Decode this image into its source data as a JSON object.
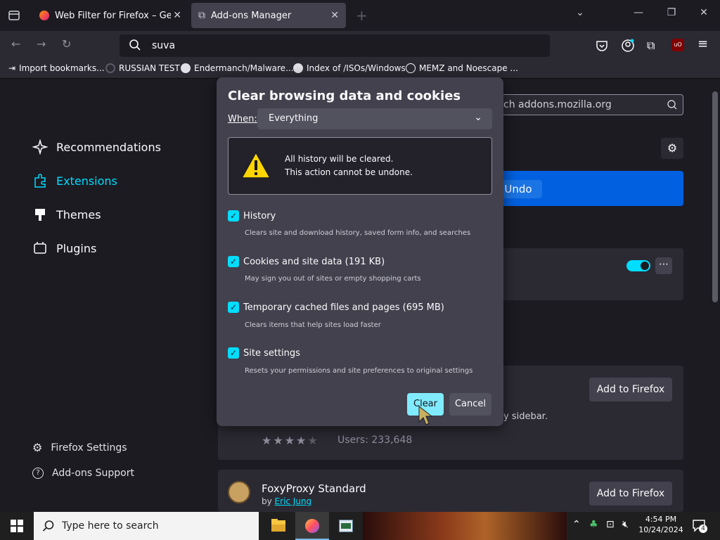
{
  "tabs": [
    {
      "label": "Web Filter for Firefox – Get this E"
    },
    {
      "label": "Add-ons Manager"
    }
  ],
  "url": "suva",
  "bookmarks": [
    {
      "label": "Import bookmarks..."
    },
    {
      "label": "RUSSIAN TEST"
    },
    {
      "label": "Endermanch/Malware..."
    },
    {
      "label": "Index of /ISOs/Windows"
    },
    {
      "label": "MEMZ and Noescape ..."
    }
  ],
  "sidebar": {
    "items": [
      {
        "label": "Recommendations"
      },
      {
        "label": "Extensions"
      },
      {
        "label": "Themes"
      },
      {
        "label": "Plugins"
      }
    ],
    "footer": [
      {
        "label": "Firefox Settings"
      },
      {
        "label": "Add-ons Support"
      }
    ]
  },
  "addons": {
    "search_placeholder": "ch addons.mozilla.org",
    "undo_label": "Undo",
    "sidebar_fragment": "y sidebar.",
    "add_to_firefox": "Add to Firefox",
    "users": "Users: 233,648",
    "foxy_name": "FoxyProxy Standard",
    "foxy_by": "by",
    "foxy_author": "Eric Jung"
  },
  "dialog": {
    "title": "Clear browsing data and cookies",
    "when_label": "When:",
    "when_value": "Everything",
    "warning_line1": "All history will be cleared.",
    "warning_line2": "This action cannot be undone.",
    "options": [
      {
        "label": "History",
        "desc": "Clears site and download history, saved form info, and searches"
      },
      {
        "label": "Cookies and site data (191 KB)",
        "desc": "May sign you out of sites or empty shopping carts"
      },
      {
        "label": "Temporary cached files and pages (695 MB)",
        "desc": "Clears items that help sites load faster"
      },
      {
        "label": "Site settings",
        "desc": "Resets your permissions and site preferences to original settings"
      }
    ],
    "clear_label": "Clear",
    "cancel_label": "Cancel"
  },
  "taskbar": {
    "search_text": "Type here to search",
    "time": "4:54 PM",
    "date": "10/24/2024",
    "notification_count": "4"
  }
}
